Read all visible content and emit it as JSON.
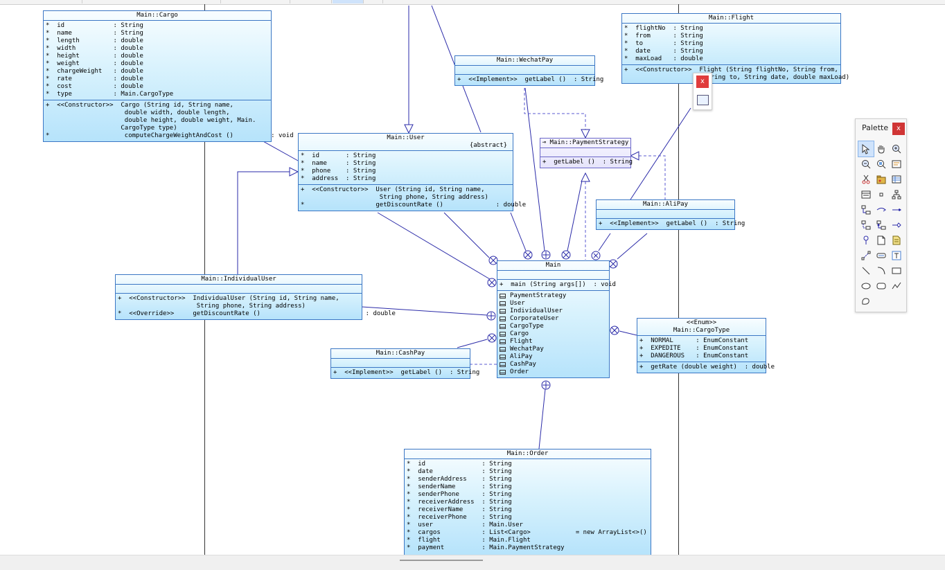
{
  "classes": {
    "cargo": {
      "name": "Main::Cargo",
      "attributes": [
        "*  id             : String",
        "*  name           : String",
        "*  length         : double",
        "*  width          : double",
        "*  height         : double",
        "*  weight         : double",
        "*  chargeWeight   : double",
        "*  rate           : double",
        "*  cost           : double",
        "*  type           : Main.CargoType"
      ],
      "operations": [
        "+  <<Constructor>>  Cargo (String id, String name,",
        "                     double width, double length,",
        "                     double height, double weight, Main.",
        "                    CargoType type)",
        "*                    computeChargeWeightAndCost ()          : void"
      ]
    },
    "flight": {
      "name": "Main::Flight",
      "attributes": [
        "*  flightNo  : String",
        "*  from      : String",
        "*  to        : String",
        "*  date      : String",
        "*  maxLoad   : double"
      ],
      "operations": [
        "+  <<Constructor>>  Flight (String flightNo, String from,",
        "                     String to, String date, double maxLoad)"
      ]
    },
    "wechatpay": {
      "name": "Main::WechatPay",
      "operations": [
        "+  <<Implement>>  getLabel ()  : String"
      ]
    },
    "user": {
      "name": "Main::User",
      "modifier": "{abstract}",
      "attributes": [
        "*  id       : String",
        "*  name     : String",
        "*  phone    : String",
        "*  address  : String"
      ],
      "operations": [
        "+  <<Constructor>>  User (String id, String name,",
        "                     String phone, String address)",
        "*                   getDiscountRate ()              : double"
      ]
    },
    "paymentstrategy": {
      "name": "Main::PaymentStrategy",
      "operations": [
        "+  getLabel ()  : String"
      ]
    },
    "alipay": {
      "name": "Main::AliPay",
      "operations": [
        "+  <<Implement>>  getLabel ()  : String"
      ]
    },
    "individualuser": {
      "name": "Main::IndividualUser",
      "operations": [
        "+  <<Constructor>>  IndividualUser (String id, String name,",
        "                     String phone, String address)",
        "*  <<Override>>     getDiscountRate ()                            : double"
      ]
    },
    "main": {
      "name": "Main",
      "operations": [
        "+  main (String args[])  : void"
      ],
      "nested": [
        "PaymentStrategy",
        "User",
        "IndividualUser",
        "CorporateUser",
        "CargoType",
        "Cargo",
        "Flight",
        "WechatPay",
        "AliPay",
        "CashPay",
        "Order"
      ]
    },
    "cashpay": {
      "name": "Main::CashPay",
      "operations": [
        "+  <<Implement>>  getLabel ()  : String"
      ]
    },
    "cargotype": {
      "stereotype": "<<Enum>>",
      "name": "Main::CargoType",
      "literals": [
        "+  NORMAL      : EnumConstant",
        "+  EXPEDITE    : EnumConstant",
        "+  DANGEROUS   : EnumConstant"
      ],
      "operations": [
        "+  getRate (double weight)  : double"
      ]
    },
    "order": {
      "name": "Main::Order",
      "attributes": [
        "*  id               : String",
        "*  date             : String",
        "*  senderAddress    : String",
        "*  senderName       : String",
        "*  senderPhone      : String",
        "*  receiverAddress  : String",
        "*  receiverName     : String",
        "*  receiverPhone    : String",
        "*  user             : Main.User",
        "*  cargos           : List<Cargo>            = new ArrayList<>()",
        "*  flight           : Main.Flight",
        "*  payment          : Main.PaymentStrategy"
      ]
    }
  },
  "floating_toolbar": {
    "close_label": "x",
    "icon": "diagram-view-icon"
  },
  "palette": {
    "title": "Palette",
    "close_label": "x",
    "tools": [
      "select-arrow-icon",
      "pan-hand-icon",
      "zoom-in-icon",
      "zoom-out-icon",
      "zoom-region-icon",
      "properties-icon",
      "cut-icon",
      "package-icon",
      "table-icon",
      "class-icon",
      "small-class-icon",
      "hierarchy-icon",
      "generalization-icon",
      "association-icon",
      "composition-icon",
      "dependency-icon",
      "realization-icon",
      "aggregation-icon",
      "pin-icon",
      "note-icon",
      "comment-icon",
      "link-icon",
      "constraint-icon",
      "text-icon",
      "line-icon",
      "curve-icon",
      "rectangle-icon",
      "ellipse-icon",
      "rounded-rectangle-icon",
      "polyline-icon",
      "freeform-icon"
    ]
  },
  "colors": {
    "class_border": "#3a76c4",
    "line": "#2a2aa8",
    "interface_fill": "#e6e4fb",
    "close_red": "#d03535"
  }
}
